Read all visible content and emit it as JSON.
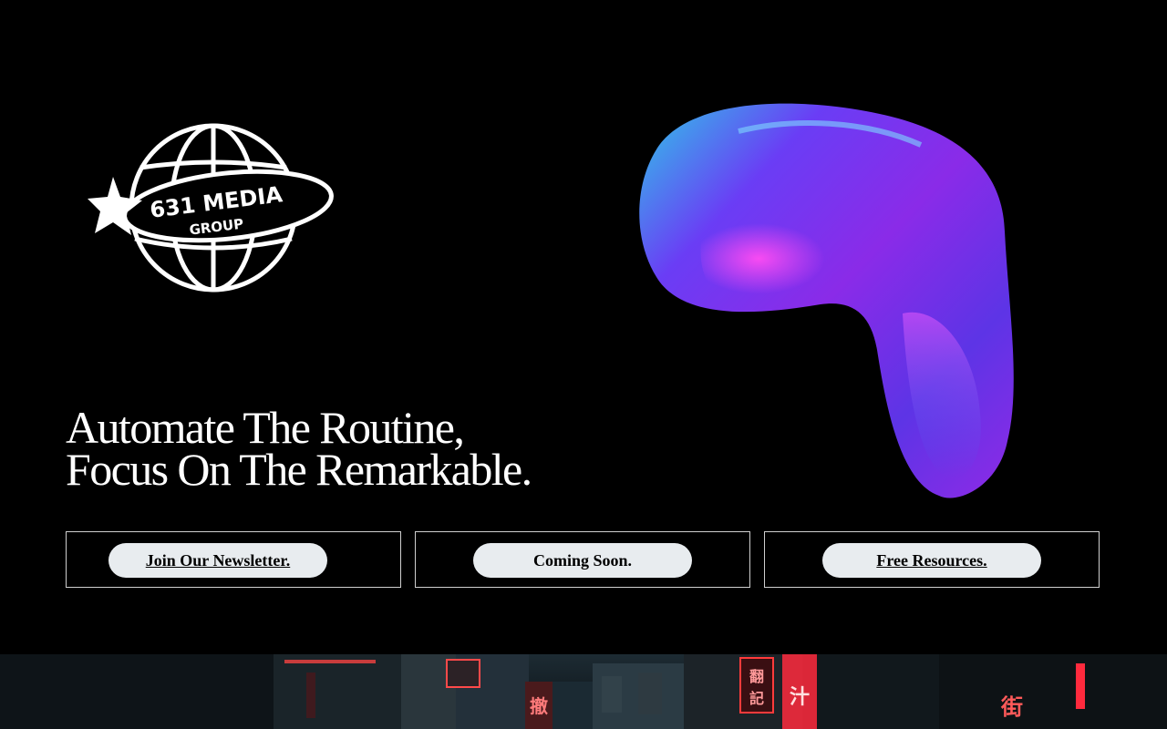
{
  "brand": {
    "logo_text_line1": "631 MEDIA",
    "logo_text_line2": "GROUP"
  },
  "hero": {
    "headline_line1": "Automate The Routine,",
    "headline_line2": "Focus On The Remarkable."
  },
  "cta": {
    "newsletter_label": "Join Our Newsletter.",
    "coming_soon_label": "Coming Soon.",
    "resources_label": "Free Resources."
  },
  "colors": {
    "background": "#000000",
    "pill": "#e8ecef",
    "blob_purple": "#7b2ff7",
    "blob_magenta": "#e23de6",
    "blob_cyan": "#2ec8e6",
    "neon_red": "#ff2a3d"
  }
}
